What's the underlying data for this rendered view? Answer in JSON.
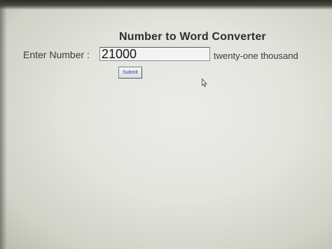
{
  "page": {
    "title": "Number to Word Converter",
    "number_label": "Enter Number :",
    "number_value": "21000",
    "result_text": "twenty-one thousand",
    "submit_label": "Submit"
  },
  "icons": {
    "cursor": "mouse-pointer-icon"
  },
  "colors": {
    "title": "#2b2f33",
    "submit_text": "#2c3cae"
  }
}
